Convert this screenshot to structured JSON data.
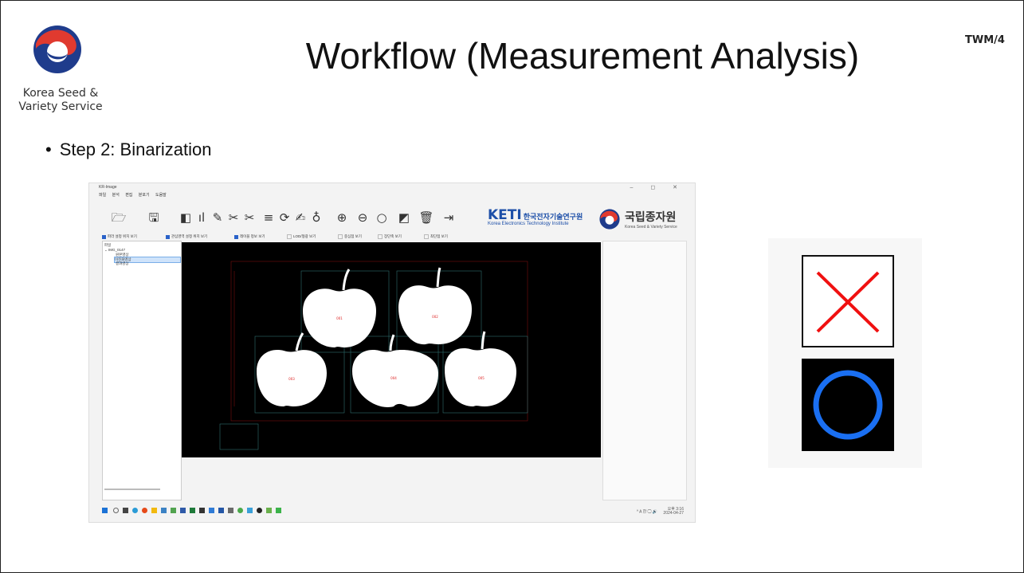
{
  "slide": {
    "title": "Workflow (Measurement Analysis)",
    "code": "TWM/4",
    "logo": {
      "icon": "korea-seed-logo",
      "line1": "Korea Seed &",
      "line2": "Variety Service"
    },
    "bullet": "Step 2: Binarization",
    "bullet_marker": "•"
  },
  "app": {
    "window_title": "KR-Image",
    "window_controls": "–  ◻  ✕",
    "menu": [
      "파일",
      "분석",
      "편집",
      "분포기",
      "도움말"
    ],
    "toolbar_icons": [
      "open-folder-icon",
      "save-icon",
      "binarize-icon",
      "histogram-icon",
      "ruler-icon",
      "scissors-icon",
      "scissors-icon",
      "filter-icon",
      "rotate-90-icon",
      "edit-icon",
      "color-pick-icon",
      "zoom-in-icon",
      "zoom-out-icon",
      "search-icon",
      "tag-icon",
      "trash-icon",
      "exit-icon"
    ],
    "keti": {
      "logo": "KETI",
      "korean": "한국전자기술연구원",
      "english": "Korea Electronics Technology Institute"
    },
    "kseed": {
      "korean": "국립종자원",
      "english": "Korea Seed & Variety Service"
    },
    "checkboxes": [
      {
        "label": "파라 설정 위치 보기",
        "checked": true
      },
      {
        "label": "관심영역 설정 위치 보기",
        "checked": true
      },
      {
        "label": "레이블 정보 보기",
        "checked": true
      },
      {
        "label": "LOD/형광 보기",
        "checked": false
      },
      {
        "label": "중심점 보기",
        "checked": false
      },
      {
        "label": "장단축 보기",
        "checked": false
      },
      {
        "label": "최단점 보기",
        "checked": false
      }
    ],
    "tree": {
      "root": "파일",
      "folder": "IMG_0147",
      "items": [
        "원본영상",
        "이진화영상",
        "결과영상"
      ],
      "selected_index": 1
    },
    "apple_labels": [
      "001",
      "002",
      "003",
      "004",
      "005"
    ],
    "taskbar_sys": "^  A  한  🖵 🔊",
    "clock_time": "오후 3:16",
    "clock_date": "2024-04-27"
  }
}
